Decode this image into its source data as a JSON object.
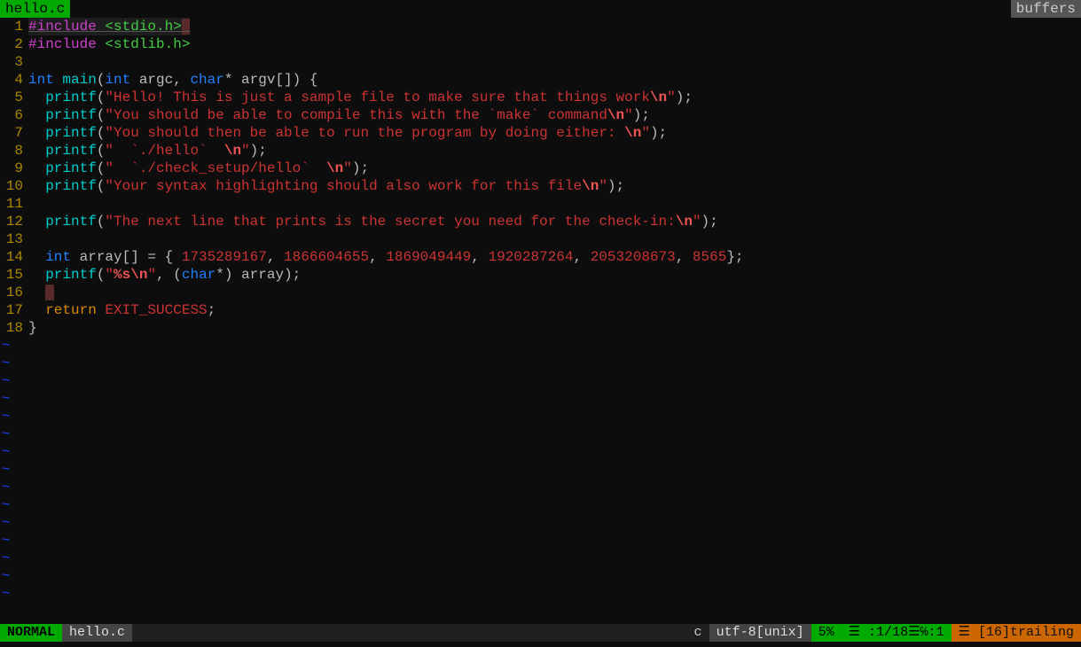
{
  "topbar": {
    "current_tab": "hello.c",
    "right_tab": "buffers"
  },
  "lines": [
    {
      "n": "1",
      "tokens": [
        [
          "prep",
          "#include "
        ],
        [
          "incl",
          "<stdio.h>"
        ]
      ],
      "cursorline": true,
      "trailing": true
    },
    {
      "n": "2",
      "tokens": [
        [
          "prep",
          "#include "
        ],
        [
          "incl",
          "<stdlib.h>"
        ]
      ]
    },
    {
      "n": "3",
      "tokens": []
    },
    {
      "n": "4",
      "tokens": [
        [
          "type",
          "int "
        ],
        [
          "func",
          "main"
        ],
        [
          "paren",
          "("
        ],
        [
          "type",
          "int "
        ],
        [
          "op",
          "argc, "
        ],
        [
          "type",
          "char"
        ],
        [
          "op",
          "* argv[]) {"
        ]
      ]
    },
    {
      "n": "5",
      "tokens": [
        [
          "op",
          "  "
        ],
        [
          "func",
          "printf"
        ],
        [
          "paren",
          "("
        ],
        [
          "str",
          "\"Hello! This is just a sample file to make sure that things work"
        ],
        [
          "esc",
          "\\n"
        ],
        [
          "str",
          "\""
        ],
        [
          "paren",
          ");"
        ]
      ]
    },
    {
      "n": "6",
      "tokens": [
        [
          "op",
          "  "
        ],
        [
          "func",
          "printf"
        ],
        [
          "paren",
          "("
        ],
        [
          "str",
          "\"You should be able to compile this with the `make` command"
        ],
        [
          "esc",
          "\\n"
        ],
        [
          "str",
          "\""
        ],
        [
          "paren",
          ");"
        ]
      ]
    },
    {
      "n": "7",
      "tokens": [
        [
          "op",
          "  "
        ],
        [
          "func",
          "printf"
        ],
        [
          "paren",
          "("
        ],
        [
          "str",
          "\"You should then be able to run the program by doing either: "
        ],
        [
          "esc",
          "\\n"
        ],
        [
          "str",
          "\""
        ],
        [
          "paren",
          ");"
        ]
      ]
    },
    {
      "n": "8",
      "tokens": [
        [
          "op",
          "  "
        ],
        [
          "func",
          "printf"
        ],
        [
          "paren",
          "("
        ],
        [
          "str",
          "\"  `./hello`  "
        ],
        [
          "esc",
          "\\n"
        ],
        [
          "str",
          "\""
        ],
        [
          "paren",
          ");"
        ]
      ]
    },
    {
      "n": "9",
      "tokens": [
        [
          "op",
          "  "
        ],
        [
          "func",
          "printf"
        ],
        [
          "paren",
          "("
        ],
        [
          "str",
          "\"  `./check_setup/hello`  "
        ],
        [
          "esc",
          "\\n"
        ],
        [
          "str",
          "\""
        ],
        [
          "paren",
          ");"
        ]
      ]
    },
    {
      "n": "10",
      "tokens": [
        [
          "op",
          "  "
        ],
        [
          "func",
          "printf"
        ],
        [
          "paren",
          "("
        ],
        [
          "str",
          "\"Your syntax highlighting should also work for this file"
        ],
        [
          "esc",
          "\\n"
        ],
        [
          "str",
          "\""
        ],
        [
          "paren",
          ");"
        ]
      ]
    },
    {
      "n": "11",
      "tokens": []
    },
    {
      "n": "12",
      "tokens": [
        [
          "op",
          "  "
        ],
        [
          "func",
          "printf"
        ],
        [
          "paren",
          "("
        ],
        [
          "str",
          "\"The next line that prints is the secret you need for the check-in:"
        ],
        [
          "esc",
          "\\n"
        ],
        [
          "str",
          "\""
        ],
        [
          "paren",
          ");"
        ]
      ]
    },
    {
      "n": "13",
      "tokens": []
    },
    {
      "n": "14",
      "tokens": [
        [
          "op",
          "  "
        ],
        [
          "type",
          "int "
        ],
        [
          "op",
          "array[] = { "
        ],
        [
          "num",
          "1735289167"
        ],
        [
          "op",
          ", "
        ],
        [
          "num",
          "1866604655"
        ],
        [
          "op",
          ", "
        ],
        [
          "num",
          "1869049449"
        ],
        [
          "op",
          ", "
        ],
        [
          "num",
          "1920287264"
        ],
        [
          "op",
          ", "
        ],
        [
          "num",
          "2053208673"
        ],
        [
          "op",
          ", "
        ],
        [
          "num",
          "8565"
        ],
        [
          "op",
          "};"
        ]
      ]
    },
    {
      "n": "15",
      "tokens": [
        [
          "op",
          "  "
        ],
        [
          "func",
          "printf"
        ],
        [
          "paren",
          "("
        ],
        [
          "str",
          "\""
        ],
        [
          "esc",
          "%s"
        ],
        [
          "esc",
          "\\n"
        ],
        [
          "str",
          "\""
        ],
        [
          "op",
          ", ("
        ],
        [
          "type",
          "char"
        ],
        [
          "op",
          "*) array);"
        ]
      ]
    },
    {
      "n": "16",
      "tokens": [
        [
          "op",
          "  "
        ]
      ],
      "trailing": true
    },
    {
      "n": "17",
      "tokens": [
        [
          "op",
          "  "
        ],
        [
          "kw",
          "return "
        ],
        [
          "const",
          "EXIT_SUCCESS"
        ],
        [
          "op",
          ";"
        ]
      ]
    },
    {
      "n": "18",
      "tokens": [
        [
          "op",
          "}"
        ]
      ]
    }
  ],
  "tilde_count": 15,
  "tilde_char": "~",
  "status": {
    "mode": "NORMAL",
    "file": "hello.c",
    "filetype": "c",
    "encoding": "utf-8[unix]",
    "percent": "5%",
    "position": "☰ :1/18☰℅:1",
    "trailing": "☰ [16]trailing"
  }
}
